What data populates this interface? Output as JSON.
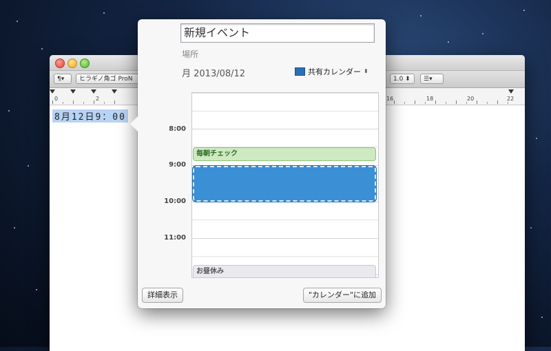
{
  "popover": {
    "title_value": "新規イベント",
    "location_placeholder": "場所",
    "date_text": "月 2013/08/12",
    "calendar_name": "共有カレンダー",
    "calendar_color": "#2b6fb6",
    "calendar_updown": "⬍",
    "time_labels": [
      "8:00",
      "9:00",
      "10:00",
      "11:00"
    ],
    "events": {
      "green_title": "毎朝チェック",
      "grey_title": "お昼休み"
    },
    "details_button": "詳細表示",
    "add_button": "\"カレンダー\"に追加"
  },
  "textedit": {
    "toolbar": {
      "paragraph": "¶▾",
      "font": "ヒラギノ角ゴ ProN",
      "spacing": "1.0 ⬍",
      "list": "☰▾"
    },
    "ruler_numbers": [
      "0",
      "2",
      "16",
      "18",
      "20",
      "22"
    ],
    "selected_text": "8月12日9：00"
  }
}
